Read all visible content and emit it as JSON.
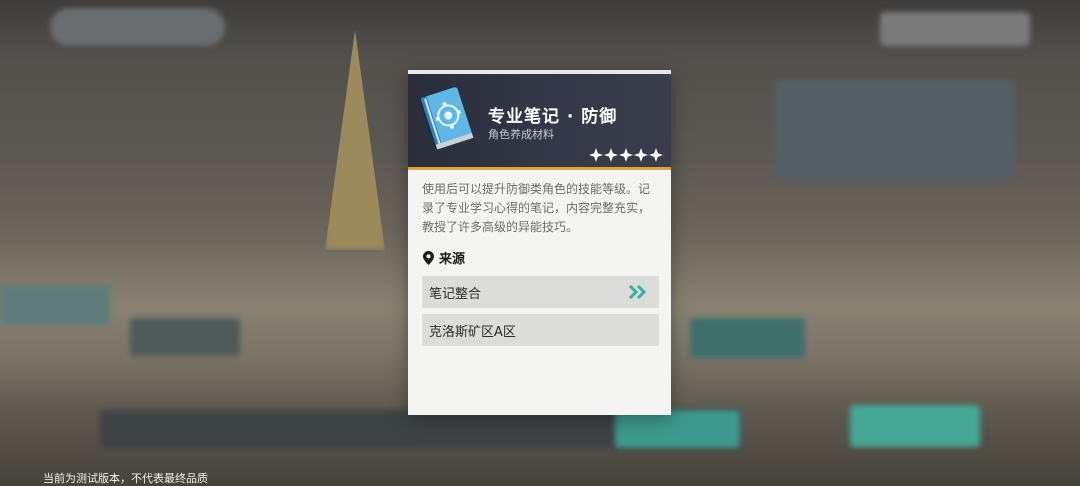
{
  "item": {
    "name": "专业笔记 · 防御",
    "type": "角色养成材料",
    "rarity_stars": 5,
    "description": "使用后可以提升防御类角色的技能等级。记录了专业学习心得的笔记，内容完整充实，教授了许多高级的异能技巧。",
    "icon": "blue-notebook-icon"
  },
  "source": {
    "heading": "来源",
    "icon": "location-pin-icon",
    "entries": [
      {
        "label": "笔记整合",
        "navigable": true,
        "nav_icon": "double-chevron-right-icon"
      },
      {
        "label": "克洛斯矿区A区",
        "navigable": false
      }
    ]
  },
  "footer": {
    "notice": "当前为测试版本，不代表最终品质"
  },
  "colors": {
    "header_bg": "#2f3241",
    "accent_gold": "#d9a43a",
    "nav_teal": "#34b4a0",
    "row_bg": "#dcdcdb"
  }
}
